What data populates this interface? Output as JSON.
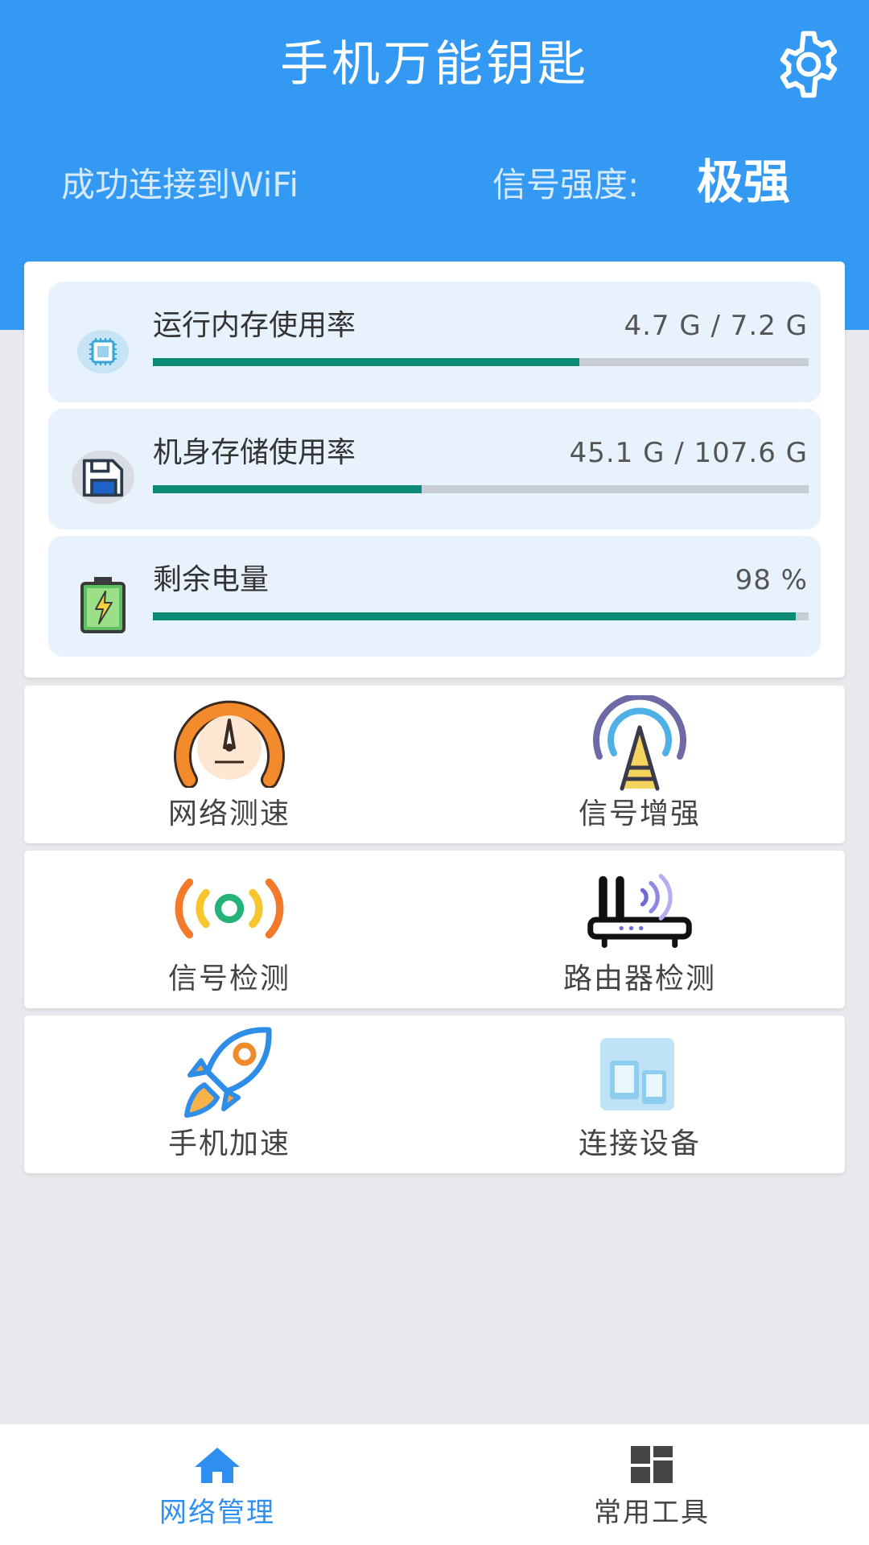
{
  "header": {
    "title": "手机万能钥匙",
    "wifi_status": "成功连接到WiFi",
    "signal_label": "信号强度:",
    "signal_value": "极强",
    "background_color": "#3399f3",
    "settings_icon": "gear-icon"
  },
  "stats": [
    {
      "label": "运行内存使用率",
      "value": "4.7 G / 7.2 G",
      "progress": 0.65,
      "icon": "chip-icon"
    },
    {
      "label": "机身存储使用率",
      "value": "45.1 G / 107.6 G",
      "progress": 0.41,
      "icon": "floppy-disk-icon"
    },
    {
      "label": "剩余电量",
      "value": "98 %",
      "progress": 0.98,
      "icon": "battery-charging-icon"
    }
  ],
  "progress_color": "#0b8a75",
  "tools": [
    {
      "label": "网络测速",
      "icon": "speedometer-icon"
    },
    {
      "label": "信号增强",
      "icon": "signal-tower-icon"
    },
    {
      "label": "信号检测",
      "icon": "signal-detect-icon"
    },
    {
      "label": "路由器检测",
      "icon": "router-icon"
    },
    {
      "label": "手机加速",
      "icon": "rocket-icon"
    },
    {
      "label": "连接设备",
      "icon": "devices-icon"
    }
  ],
  "bottom_nav": [
    {
      "label": "网络管理",
      "icon": "home-icon",
      "active": true,
      "color": "#2f8ff0"
    },
    {
      "label": "常用工具",
      "icon": "grid-icon",
      "active": false,
      "color": "#444444"
    }
  ]
}
